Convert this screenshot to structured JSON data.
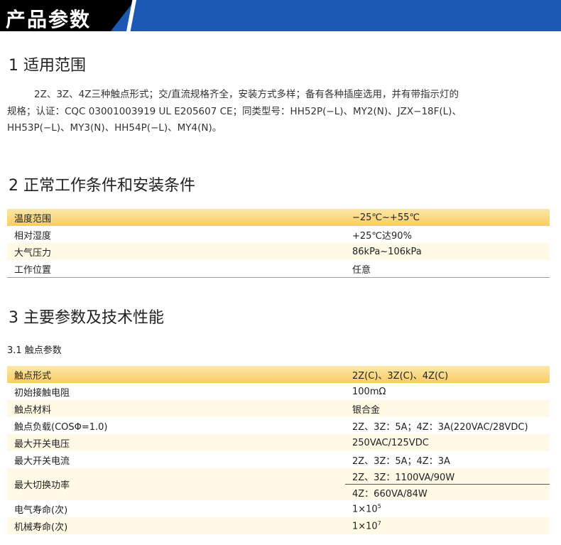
{
  "header": {
    "title": "产品参数"
  },
  "section1": {
    "heading": "1 适用范围",
    "lines": [
      "2Z、3Z、4Z三种触点形式；交/直流规格齐全，安装方式多样；备有各种插座选用，并有带指示灯的",
      "规格；认证：CQC 03001003919 UL E205607 CE；同类型号：HH52P(−L)、MY2(N)、JZX−18F(L)、",
      "HH53P(−L)、MY3(N)、HH54P(−L)、MY4(N)。"
    ]
  },
  "section2": {
    "heading": "2 正常工作条件和安装条件",
    "rows": [
      {
        "label": "温度范围",
        "value": "−25℃~+55℃"
      },
      {
        "label": "相对湿度",
        "value": "+25℃达90%"
      },
      {
        "label": "大气压力",
        "value": "86kPa~106kPa"
      },
      {
        "label": "工作位置",
        "value": "任意"
      }
    ]
  },
  "section3": {
    "heading": "3 主要参数及技术性能",
    "subheading": "3.1 触点参数",
    "rows": [
      {
        "label": "触点形式",
        "value": "2Z(C)、3Z(C)、4Z(C)"
      },
      {
        "label": "初始接触电阻",
        "value": "100mΩ"
      },
      {
        "label": "触点材料",
        "value": "银合金"
      },
      {
        "label": "触点负载(COSΦ=1.0)",
        "value": "2Z、3Z：5A；4Z：3A(220VAC/28VDC)"
      },
      {
        "label": "最大开关电压",
        "value": "250VAC/125VDC"
      },
      {
        "label": "最大开关电流",
        "value": "2Z、3Z：5A；4Z：3A"
      },
      {
        "label": "最大切换功率",
        "value": "2Z、3Z：1100VA/90W",
        "value2": "4Z：660VA/84W"
      },
      {
        "label": "电气寿命(次)",
        "value_base": "1×10",
        "value_exp": "5"
      },
      {
        "label": "机械寿命(次)",
        "value_base": "1×10",
        "value_exp": "7"
      }
    ]
  }
}
